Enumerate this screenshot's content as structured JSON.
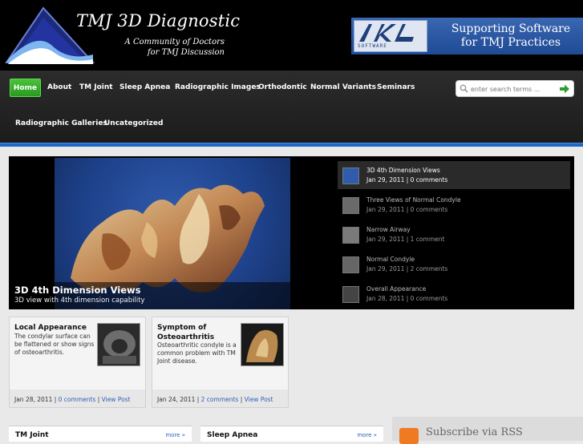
{
  "header": {
    "site_title": "TMJ 3D Diagnostic",
    "tagline_line1": "A Community of Doctors",
    "tagline_line2": "for TMJ Discussion",
    "banner_line1": "Supporting Software",
    "banner_line2": "for TMJ Practices",
    "banner_logo_text": "SOFTWARE"
  },
  "nav": {
    "items": [
      "Home",
      "About",
      "TM Joint",
      "Sleep Apnea",
      "Radiographic Images",
      "Orthodontic",
      "Normal Variants",
      "Seminars",
      "Radiographic Galleries",
      "Uncategorized"
    ],
    "active": "Home",
    "search_placeholder": "enter search terms ..."
  },
  "slider": {
    "caption_title": "3D 4th Dimension Views",
    "caption_text": "3D view with 4th dimension capability",
    "thumbs": [
      {
        "title": "3D 4th Dimension Views",
        "date": "Jan 29, 2011",
        "comments": "0 comments"
      },
      {
        "title": "Three Views of Normal Condyle",
        "date": "Jan 29, 2011",
        "comments": "0 comments"
      },
      {
        "title": "Narrow Airway",
        "date": "Jan 29, 2011",
        "comments": "1 comment"
      },
      {
        "title": "Normal Condyle",
        "date": "Jan 29, 2011",
        "comments": "2 comments"
      },
      {
        "title": "Overall Appearance",
        "date": "Jan 28, 2011",
        "comments": "0 comments"
      }
    ]
  },
  "posts": [
    {
      "title": "Local Appearance",
      "excerpt_lines": [
        "The condylar surface can",
        "be flattened or show signs",
        "of osteoarthritis."
      ],
      "date": "Jan 28, 2011",
      "comments": "0 comments",
      "view": "View Post"
    },
    {
      "title_line1": "Symptom of",
      "title_line2": "Osteoarthritis",
      "excerpt_lines": [
        "Osteoarthritic condyle is a",
        "common problem with TM",
        "Joint disease."
      ],
      "date": "Jan 24, 2011",
      "comments": "2 comments",
      "view": "View Post"
    }
  ],
  "widgets": [
    {
      "title": "TM Joint",
      "more": "more »"
    },
    {
      "title": "Sleep Apnea",
      "more": "more »"
    }
  ],
  "rss": {
    "label": "Subscribe via RSS"
  },
  "colors": {
    "accent_green": "#2a9a1f",
    "accent_blue": "#1f68c8",
    "link_blue": "#2c5fb8"
  }
}
